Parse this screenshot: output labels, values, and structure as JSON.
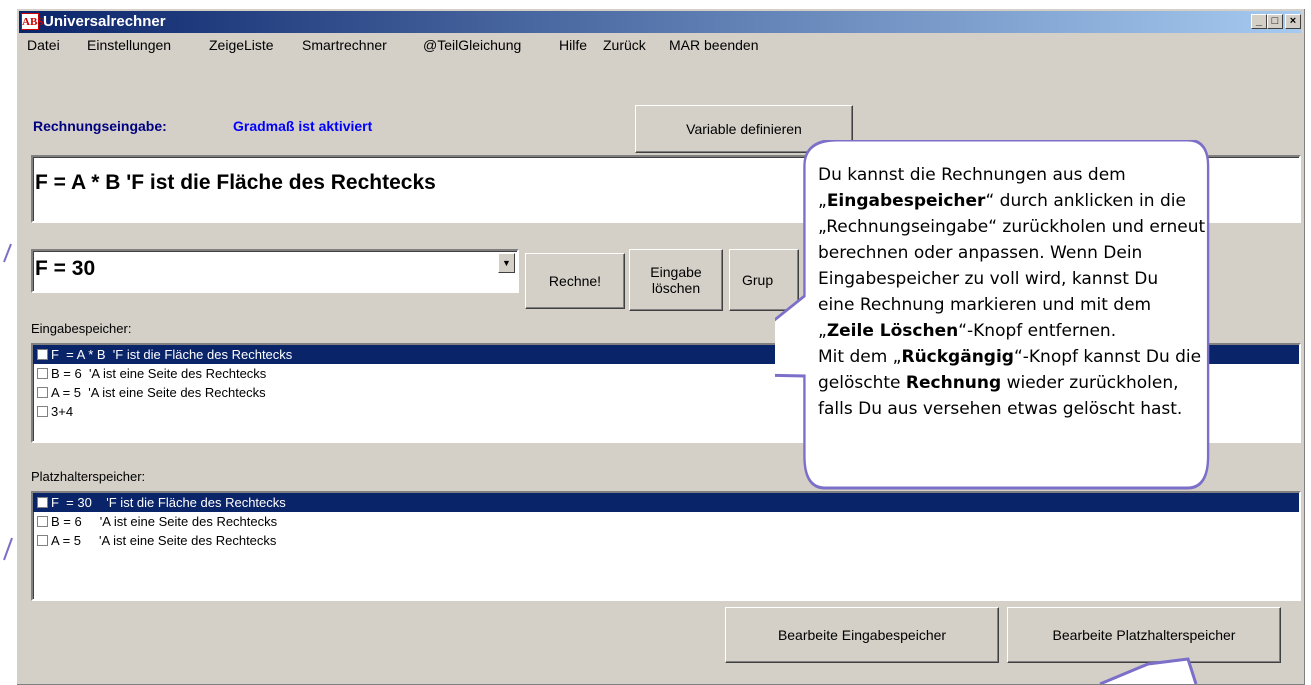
{
  "window": {
    "icon_label": "ABS",
    "title": "Universalrechner",
    "minimize": "_",
    "maximize": "□",
    "close": "×"
  },
  "menu": [
    "Datei",
    "Einstellungen",
    "ZeigeListe",
    "Smartrechner",
    "@TeilGleichung",
    "Hilfe",
    "Zurück",
    "MAR beenden"
  ],
  "labels": {
    "rechnungseingabe": "Rechnungseingabe:",
    "gradmass": "Gradmaß ist aktiviert",
    "eingabespeicher": "Eingabespeicher:",
    "platzhalterspeicher": "Platzhalterspeicher:"
  },
  "buttons": {
    "variable_definieren": "Variable definieren",
    "rechne": "Rechne!",
    "eingabe_loeschen": "Eingabe\nlöschen",
    "gruppe": "Grup",
    "bearbeite_eingabe": "Bearbeite Eingabespeicher",
    "bearbeite_platzhalter": "Bearbeite Platzhalterspeicher"
  },
  "input": {
    "rechnung": "F  = A * B  'F ist die Fläche des Rechtecks",
    "result": "F  = 30"
  },
  "eingabespeicher": [
    "F  = A * B  'F ist die Fläche des Rechtecks",
    "B = 6  'A ist eine Seite des Rechtecks",
    "A = 5  'A ist eine Seite des Rechtecks",
    "3+4"
  ],
  "platzhalterspeicher": [
    "F  = 30    'F ist die Fläche des Rechtecks",
    "B = 6     'A ist eine Seite des Rechtecks",
    "A = 5     'A ist eine Seite des Rechtecks"
  ],
  "callout": {
    "line1": "Du kannst die Rechnungen aus dem",
    "line2_pre": "„",
    "line2_bold": "Eingabespeicher",
    "line2_post": "“ durch anklicken in die",
    "line3": "„Rechnungseingabe“ zurückholen und erneut",
    "line4": "berechnen oder anpassen. Wenn Dein",
    "line5": "Eingabespeicher zu voll wird, kannst Du",
    "line6": "eine Rechnung markieren und mit dem",
    "line7_pre": "„",
    "line7_bold": "Zeile Löschen",
    "line7_post": "“-Knopf entfernen.",
    "line8_pre": "Mit dem „",
    "line8_bold": "Rückgängig",
    "line8_post": "“-Knopf kannst Du die",
    "line9_pre": "gelöschte ",
    "line9_bold": "Rechnung",
    "line9_post": " wieder zurückholen,",
    "line10": "falls Du aus versehen etwas gelöscht hast."
  }
}
